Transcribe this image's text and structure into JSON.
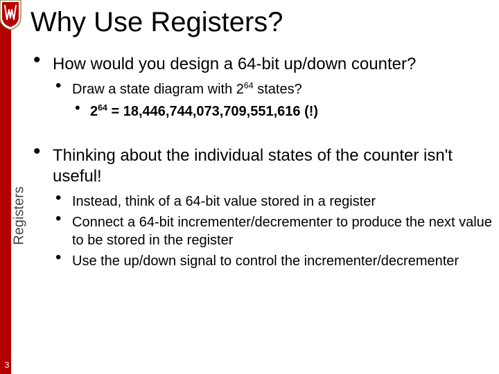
{
  "title": "Why Use Registers?",
  "side_label": "Registers",
  "page_number": "3",
  "bullets": {
    "b1": {
      "text": "How would you design a 64-bit up/down counter?",
      "sub1": {
        "pre": "Draw a state diagram with 2",
        "sup": "64",
        "post": " states?",
        "subsub": {
          "pre": "2",
          "sup": "64",
          "post": " = 18,446,744,073,709,551,616 (!)"
        }
      }
    },
    "b2": {
      "text": "Thinking about the individual states of the counter isn't useful!",
      "s1": "Instead, think of a 64-bit value stored in a register",
      "s2": "Connect a 64-bit incrementer/decrementer to produce the next value to be stored in the register",
      "s3": "Use the up/down signal to control the incrementer/decrementer"
    }
  }
}
